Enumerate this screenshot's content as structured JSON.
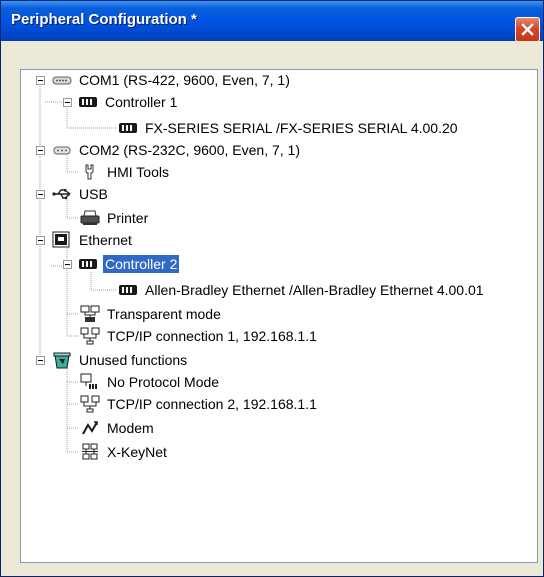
{
  "window": {
    "title": "Peripheral Configuration *"
  },
  "tree": {
    "com1": "COM1 (RS-422, 9600, Even, 7, 1)",
    "controller1": "Controller 1",
    "fx_driver": "FX-SERIES SERIAL /FX-SERIES SERIAL  4.00.20",
    "com2": "COM2 (RS-232C, 9600, Even, 7, 1)",
    "hmi_tools": "HMI Tools",
    "usb": "USB",
    "printer": "Printer",
    "ethernet": "Ethernet",
    "controller2": "Controller 2",
    "ab_driver": "Allen-Bradley Ethernet /Allen-Bradley Ethernet  4.00.01",
    "transparent": "Transparent mode",
    "tcp1": "TCP/IP connection 1, 192.168.1.1",
    "unused": "Unused functions",
    "no_protocol": "No Protocol Mode",
    "tcp2": "TCP/IP connection 2, 192.168.1.1",
    "modem": "Modem",
    "xkeynet": "X-KeyNet"
  },
  "colors": {
    "selection": "#316ac5",
    "titlebar": "#0054e3"
  }
}
